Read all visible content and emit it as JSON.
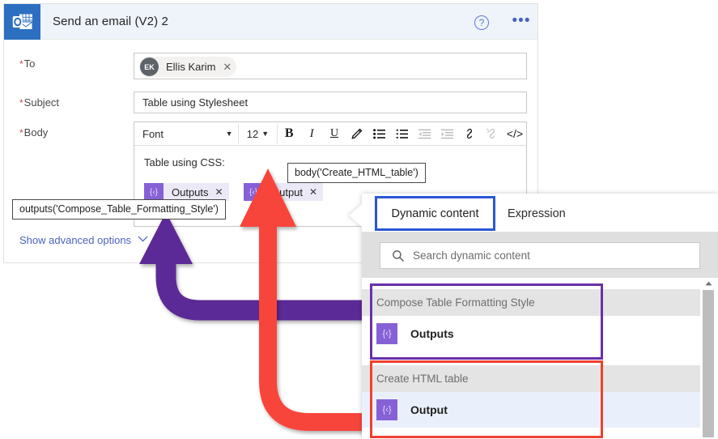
{
  "card": {
    "connector_icon": "outlook-icon",
    "title": "Send an email (V2) 2",
    "help_icon": "?",
    "more_icon": "•••",
    "fields": {
      "to": {
        "label": "To",
        "required_marker": "*",
        "chip": {
          "initials": "EK",
          "name": "Ellis Karim",
          "remove_icon": "✕"
        }
      },
      "subject": {
        "label": "Subject",
        "required_marker": "*",
        "value": "Table using Stylesheet"
      },
      "body": {
        "label": "Body",
        "required_marker": "*",
        "toolbar": {
          "font_label": "Font",
          "font_caret": "▼",
          "size_label": "12",
          "size_caret": "▼",
          "bold": "B",
          "italic": "I",
          "underline": "U",
          "text_color": "✎",
          "bulleted_list": "☰",
          "numbered_list": "≡",
          "decrease_indent": "←",
          "increase_indent": "→",
          "link": "ὑ7",
          "unlink": "⛓",
          "code_view": "</>"
        },
        "content_line": "Table using CSS:",
        "tokens": [
          {
            "glyph": "{‹}",
            "label": "Outputs",
            "remove_icon": "✕"
          },
          {
            "glyph": "{‹}",
            "label": "Output",
            "remove_icon": "✕"
          }
        ]
      }
    },
    "show_advanced_options": {
      "label": "Show advanced options",
      "chevron": "⌄"
    }
  },
  "tooltips": {
    "outputs_expression": "outputs('Compose_Table_Formatting_Style')",
    "body_expression": "body('Create_HTML_table')"
  },
  "dynamic_panel": {
    "tabs": [
      {
        "label": "Dynamic content",
        "selected": true
      },
      {
        "label": "Expression",
        "selected": false
      }
    ],
    "search": {
      "placeholder": "Search dynamic content",
      "icon": "search-icon",
      "value": ""
    },
    "groups": [
      {
        "name": "Compose Table Formatting Style",
        "items": [
          {
            "glyph": "{‹}",
            "label": "Outputs"
          }
        ]
      },
      {
        "name": "Create HTML table",
        "items": [
          {
            "glyph": "{‹}",
            "label": "Output"
          }
        ]
      }
    ],
    "scrollbar": {
      "up_arrow": "▲"
    }
  },
  "annotations": {
    "purple_arrow": {
      "color": "#5b2b96",
      "points_to": "Outputs token"
    },
    "red_arrow": {
      "color": "#f8443a",
      "points_to": "Output token"
    },
    "highlight_purple": {
      "color": "#6b2fab"
    },
    "highlight_red": {
      "color": "#f0402f"
    },
    "tab_highlight": {
      "color": "#2b57d4"
    }
  }
}
